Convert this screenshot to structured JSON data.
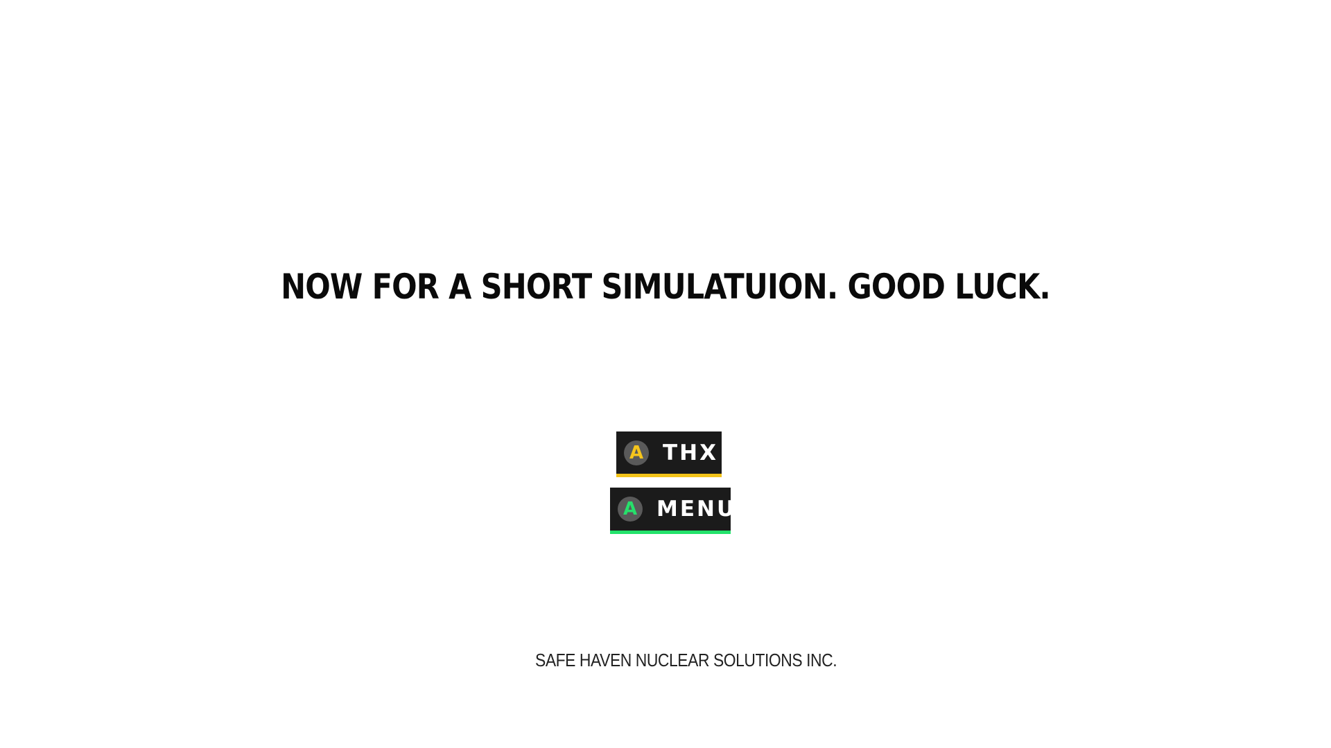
{
  "message": {
    "text": "NOW FOR A SHORT SIMULATUION. GOOD LUCK."
  },
  "buttons": {
    "thx": {
      "key": "A",
      "label": "THX",
      "accent": "#f3c318"
    },
    "menu": {
      "key": "A",
      "label": "MENU",
      "accent": "#23e26b"
    }
  },
  "footer": {
    "logo_icon": "atom-logo-icon",
    "company": "SAFE HAVEN NUCLEAR SOLUTIONS INC."
  },
  "colors": {
    "background": "#ffffff",
    "button_bg": "#1b1b1b",
    "text": "#0a0a0a"
  }
}
